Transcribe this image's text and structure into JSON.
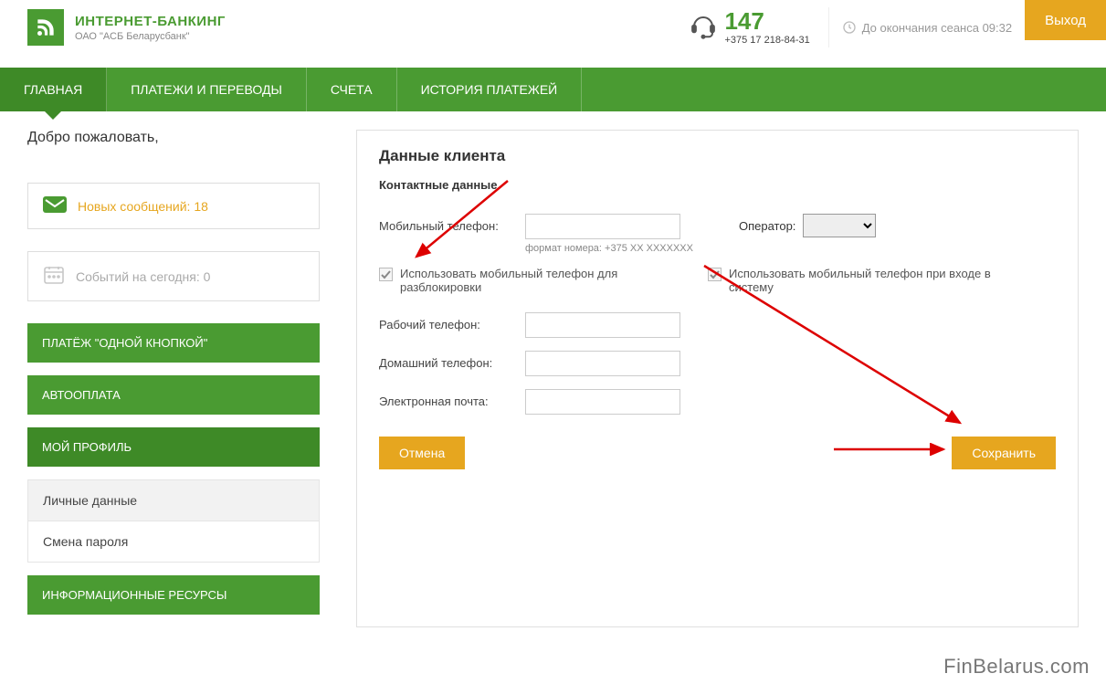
{
  "header": {
    "brand_title": "ИНТЕРНЕТ-БАНКИНГ",
    "brand_subtitle": "ОАО \"АСБ Беларусбанк\"",
    "support_number": "147",
    "support_phone": "+375 17 218-84-31",
    "session_label": "До окончания сеанса 09:32",
    "exit_label": "Выход"
  },
  "nav": {
    "items": [
      "ГЛАВНАЯ",
      "ПЛАТЕЖИ И ПЕРЕВОДЫ",
      "СЧЕТА",
      "ИСТОРИЯ ПЛАТЕЖЕЙ"
    ]
  },
  "sidebar": {
    "welcome": "Добро пожаловать,",
    "messages_label": "Новых сообщений: 18",
    "events_label": "Событий на сегодня: 0",
    "one_click": "ПЛАТЁЖ \"ОДНОЙ КНОПКОЙ\"",
    "autopay": "АВТООПЛАТА",
    "profile": "МОЙ ПРОФИЛЬ",
    "profile_sub": {
      "personal": "Личные данные",
      "password": "Смена пароля"
    },
    "resources": "ИНФОРМАЦИОННЫЕ РЕСУРСЫ"
  },
  "main": {
    "title": "Данные клиента",
    "section": "Контактные данные",
    "mobile_label": "Мобильный телефон:",
    "mobile_hint": "формат номера: +375 XX XXXXXXX",
    "operator_label": "Оператор:",
    "check_unlock": "Использовать мобильный телефон для разблокировки",
    "check_login": "Использовать мобильный телефон при входе в систему",
    "work_label": "Рабочий телефон:",
    "home_label": "Домашний телефон:",
    "email_label": "Электронная почта:",
    "cancel": "Отмена",
    "save": "Сохранить"
  },
  "watermark": "FinBelarus.com"
}
